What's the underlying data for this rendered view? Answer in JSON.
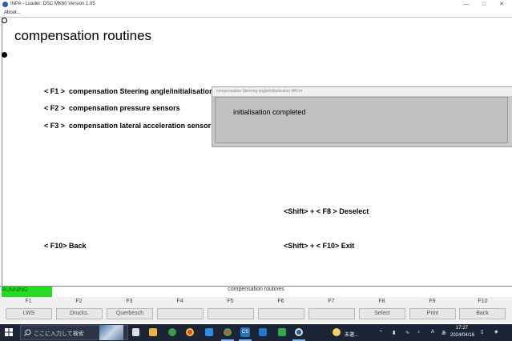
{
  "window": {
    "title": "INPA - Loader:  DSC MK60 Version 1.05",
    "menu": [
      "About..."
    ],
    "controls": [
      "minimize",
      "maximize",
      "close"
    ]
  },
  "screen": {
    "heading": "compensation routines",
    "menu_items": [
      {
        "key": "< F1 >",
        "label": "compensation Steering angle/initialisation"
      },
      {
        "key": "< F2 >",
        "label": "compensation pressure sensors"
      },
      {
        "key": "< F3 >",
        "label": "compensation lateral acceleration sensor"
      }
    ],
    "shortcuts": {
      "deselect": "<Shift> + < F8 >  Deselect",
      "back": "< F10>  Back",
      "exit": "<Shift> + < F10>  Exit"
    }
  },
  "dialog": {
    "title": "compensation Steering angle/initialisation WN fn",
    "message": "initialisation completed"
  },
  "status": {
    "running": "RUNNING",
    "text": "compensation routines",
    "running_color": "#22dd22"
  },
  "function_keys": [
    {
      "num": "F1",
      "label": "LWS"
    },
    {
      "num": "F2",
      "label": "Drucks."
    },
    {
      "num": "F3",
      "label": "Querbesch"
    },
    {
      "num": "F4",
      "label": ""
    },
    {
      "num": "F5",
      "label": ""
    },
    {
      "num": "F6",
      "label": ""
    },
    {
      "num": "F7",
      "label": ""
    },
    {
      "num": "F8",
      "label": "Select"
    },
    {
      "num": "F9",
      "label": "Print"
    },
    {
      "num": "F10",
      "label": "Back"
    }
  ],
  "taskbar": {
    "search_placeholder": "ここに入力して検索",
    "weather": "未選...",
    "time": "17:27",
    "date": "2024/04/16",
    "icons": [
      "windows-start-icon",
      "search-icon",
      "task-view-icon",
      "explorer-icon",
      "edge-icon",
      "chrome-icon",
      "vscode-icon",
      "chrome-icon",
      "cs-icon",
      "download-icon",
      "bmw-icon"
    ]
  }
}
